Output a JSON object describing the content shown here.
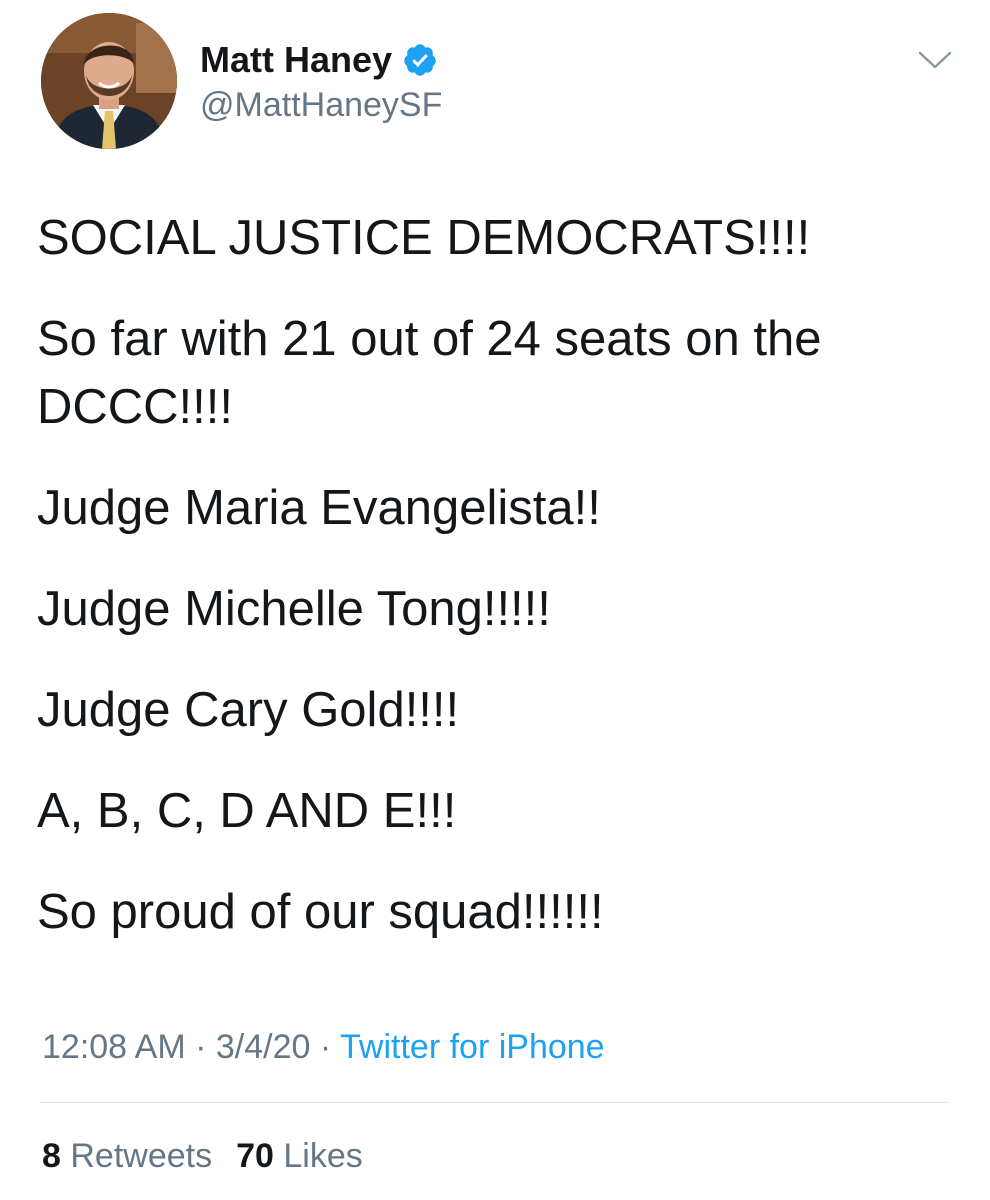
{
  "author": {
    "display_name": "Matt Haney",
    "handle": "@MattHaneySF",
    "verified": true,
    "avatar_icon": "avatar-photo"
  },
  "tweet": {
    "lines": [
      "SOCIAL JUSTICE DEMOCRATS!!!!",
      "So far with 21 out of 24 seats on the DCCC!!!!",
      "Judge Maria Evangelista!!",
      "Judge Michelle Tong!!!!!",
      "Judge Cary Gold!!!!",
      "A, B, C, D AND E!!!",
      "So proud of our squad!!!!!!"
    ]
  },
  "meta": {
    "time": "12:08 AM",
    "separator": " · ",
    "date": "3/4/20",
    "source": "Twitter for iPhone"
  },
  "stats": {
    "retweets_count": "8",
    "retweets_label": "Retweets",
    "likes_count": "70",
    "likes_label": "Likes"
  },
  "colors": {
    "text": "#14171a",
    "muted": "#657786",
    "link": "#1da1f2",
    "verified": "#1da1f2",
    "divider": "#dfe3e7"
  }
}
